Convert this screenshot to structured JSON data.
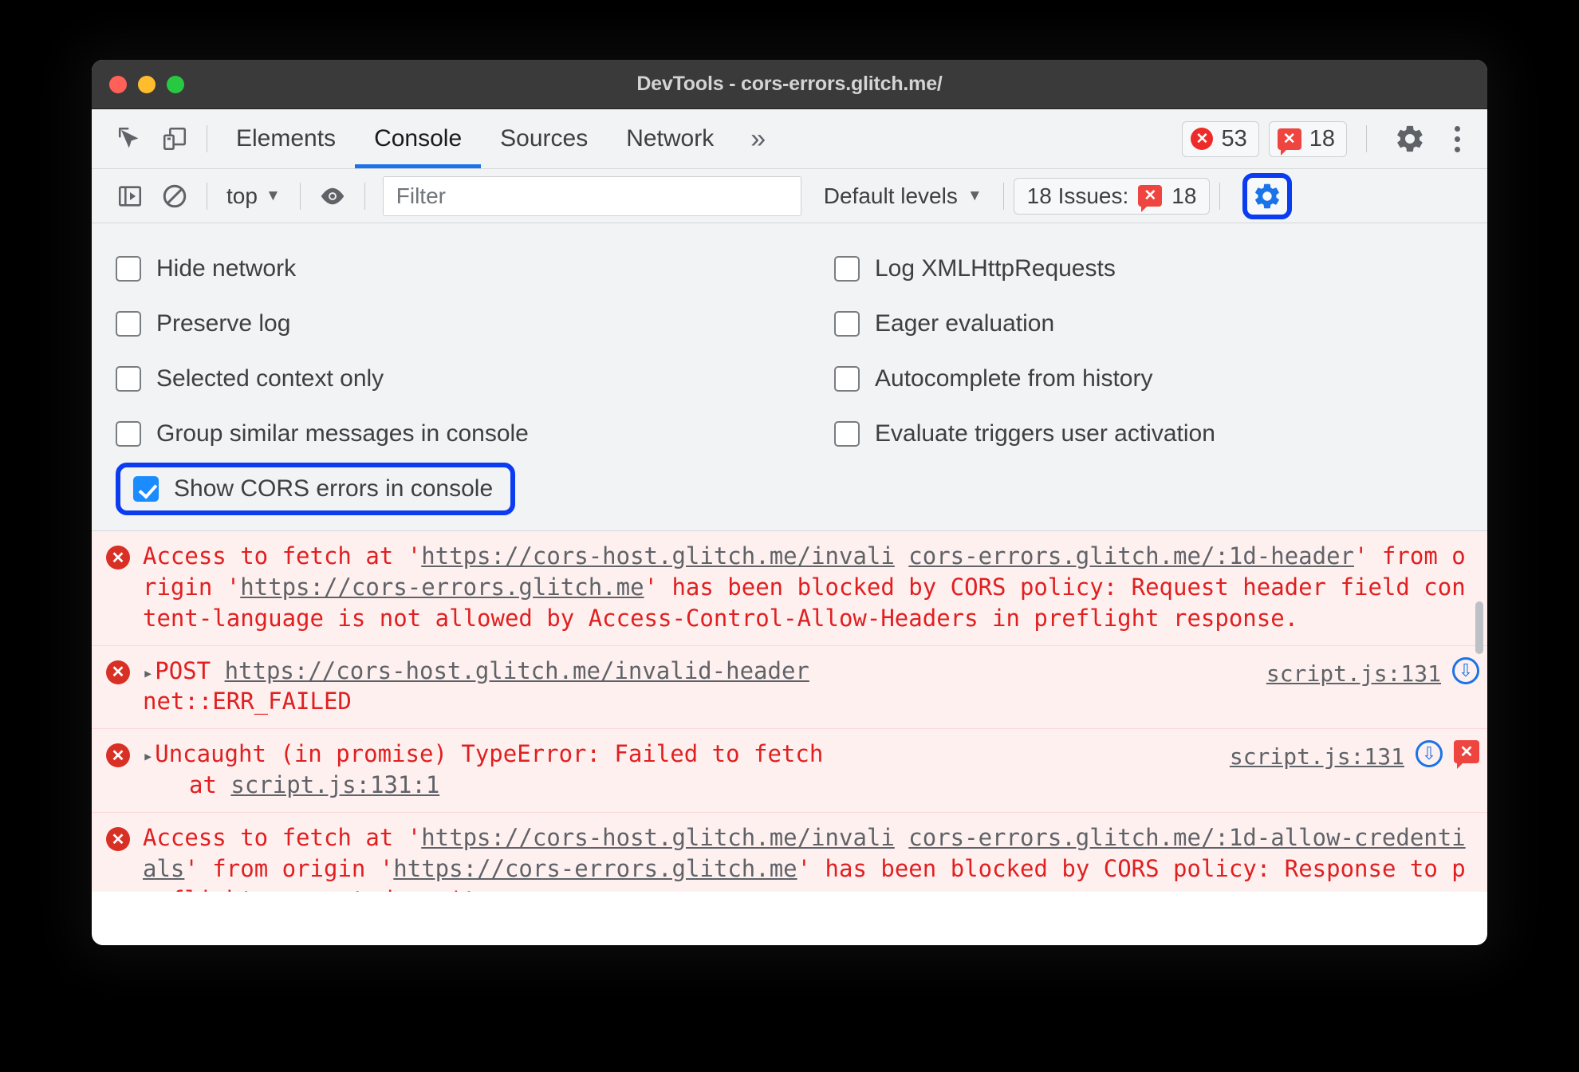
{
  "window": {
    "title": "DevTools - cors-errors.glitch.me/",
    "traffic_icons": [
      "close-dot",
      "minimize-dot",
      "maximize-dot"
    ]
  },
  "tabbar": {
    "inspect_icon": "inspect-cursor-icon",
    "device_icon": "device-toolbar-icon",
    "tabs": [
      {
        "label": "Elements",
        "active": false
      },
      {
        "label": "Console",
        "active": true
      },
      {
        "label": "Sources",
        "active": false
      },
      {
        "label": "Network",
        "active": false
      }
    ],
    "more_tabs_label": "»",
    "error_count": "53",
    "issue_count": "18",
    "settings_icon": "gear-icon",
    "menu_icon": "kebab-menu-icon"
  },
  "console_toolbar": {
    "sidebar_icon": "console-sidebar-icon",
    "clear_icon": "clear-console-icon",
    "context_label": "top",
    "context_caret": "▼",
    "live_expression_icon": "eye-icon",
    "filter_placeholder": "Filter",
    "filter_value": "",
    "levels_label": "Default levels",
    "levels_caret": "▼",
    "issues_label": "18 Issues:",
    "issues_count": "18",
    "settings_icon": "gear-icon",
    "settings_highlight_color": "#0b3cf0"
  },
  "settings": {
    "left": [
      {
        "label": "Hide network",
        "checked": false
      },
      {
        "label": "Preserve log",
        "checked": false
      },
      {
        "label": "Selected context only",
        "checked": false
      },
      {
        "label": "Group similar messages in console",
        "checked": false
      },
      {
        "label": "Show CORS errors in console",
        "checked": true,
        "highlighted": true
      }
    ],
    "right": [
      {
        "label": "Log XMLHttpRequests",
        "checked": false
      },
      {
        "label": "Eager evaluation",
        "checked": false
      },
      {
        "label": "Autocomplete from history",
        "checked": false
      },
      {
        "label": "Evaluate triggers user activation",
        "checked": false
      }
    ]
  },
  "console": {
    "messages": [
      {
        "icon": "error-circle-icon",
        "parts": [
          {
            "t": "Access to fetch at '",
            "k": "text"
          },
          {
            "t": "https://cors-host.glitch.me/invali",
            "k": "link"
          },
          {
            "t": " ",
            "k": "text"
          },
          {
            "t": "cors-errors.glitch.me/:1",
            "k": "src-inline"
          },
          {
            "t": "d-header",
            "k": "link"
          },
          {
            "t": "' from origin '",
            "k": "text"
          },
          {
            "t": "https://cors-errors.glitch.me",
            "k": "link"
          },
          {
            "t": "' has been blocked by CORS policy: Request header field content-language is not allowed by Access-Control-Allow-Headers in preflight response.",
            "k": "text"
          }
        ],
        "source": "",
        "badges": []
      },
      {
        "icon": "error-circle-icon",
        "parts": [
          {
            "t": "▸",
            "k": "triangle"
          },
          {
            "t": "POST ",
            "k": "text"
          },
          {
            "t": "https://cors-host.glitch.me/invalid-header",
            "k": "link"
          },
          {
            "t": "\nnet::ERR_FAILED",
            "k": "text"
          }
        ],
        "source": "script.js:131",
        "badges": [
          "download-arrow-icon"
        ]
      },
      {
        "icon": "error-circle-icon",
        "parts": [
          {
            "t": "▸",
            "k": "triangle"
          },
          {
            "t": "Uncaught (in promise) TypeError: Failed to fetch",
            "k": "text"
          },
          {
            "t": "\n    at ",
            "k": "text-indent"
          },
          {
            "t": "script.js:131:1",
            "k": "link"
          }
        ],
        "source": "script.js:131",
        "badges": [
          "download-arrow-icon",
          "issue-bubble-icon"
        ]
      },
      {
        "icon": "error-circle-icon",
        "parts": [
          {
            "t": "Access to fetch at '",
            "k": "text"
          },
          {
            "t": "https://cors-host.glitch.me/invali",
            "k": "link"
          },
          {
            "t": " ",
            "k": "text"
          },
          {
            "t": "cors-errors.glitch.me/:1",
            "k": "src-inline"
          },
          {
            "t": "d-allow-credentials",
            "k": "link"
          },
          {
            "t": "' from origin '",
            "k": "text"
          },
          {
            "t": "https://cors-errors.glitch.me",
            "k": "link"
          },
          {
            "t": "' has been blocked by CORS policy: Response to preflight request doesn't pass access",
            "k": "text"
          }
        ],
        "source": "",
        "badges": []
      }
    ],
    "msg1_line1_a": "Access to fetch at '",
    "msg1_url1": "https://cors-host.glitch.me/invali",
    "msg1_src": "cors-errors.glitch.me/:1",
    "msg1_line2_a": "d-header",
    "msg1_line2_b": "' from origin '",
    "msg1_url2": "https://cors-errors.glitch.me",
    "msg1_rest": "' has been blocked by CORS policy: Request header field content-language is not allowed by Access-Control-Allow-Headers in preflight response.",
    "msg2_method": "POST ",
    "msg2_url": "https://cors-host.glitch.me/invalid-header",
    "msg2_line2": "net::ERR_FAILED",
    "msg2_src": "script.js:131",
    "msg3_text": "Uncaught (in promise) TypeError: Failed to fetch",
    "msg3_at": "at ",
    "msg3_link": "script.js:131:1",
    "msg3_src": "script.js:131",
    "msg4_line1_a": "Access to fetch at '",
    "msg4_url1": "https://cors-host.glitch.me/invali",
    "msg4_src": "cors-errors.glitch.me/:1",
    "msg4_line2_a": "d-allow-credentials",
    "msg4_line2_b": "' from origin '",
    "msg4_url2": "https://cors-errors.glitch.me",
    "msg4_rest1": "' has been",
    "msg4_rest2": "blocked by CORS policy: Response to preflight request doesn't pass access"
  }
}
